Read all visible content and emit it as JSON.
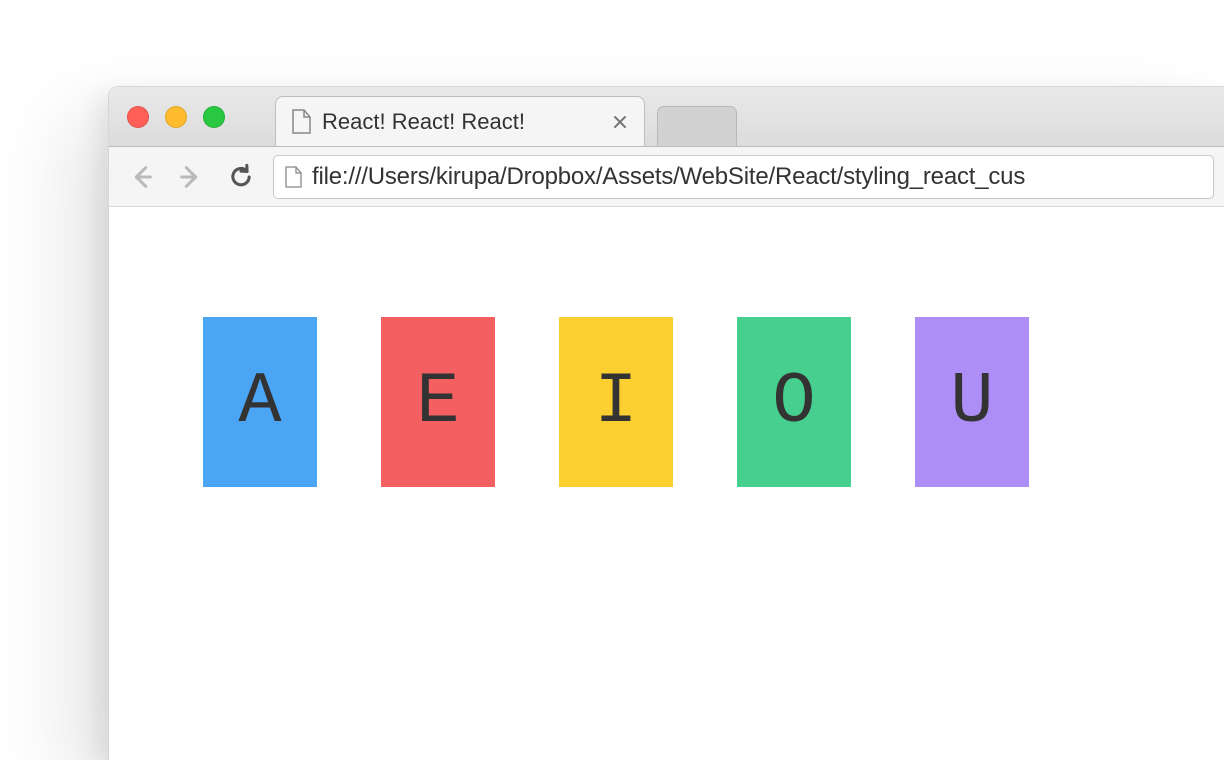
{
  "tab": {
    "title": "React! React! React!"
  },
  "urlbar": {
    "url": "file:///Users/kirupa/Dropbox/Assets/WebSite/React/styling_react_cus"
  },
  "letters": [
    {
      "char": "A",
      "color": "#4aa6f4"
    },
    {
      "char": "E",
      "color": "#f46061"
    },
    {
      "char": "I",
      "color": "#fbcf2f"
    },
    {
      "char": "O",
      "color": "#47cf8f"
    },
    {
      "char": "U",
      "color": "#ad8df6"
    }
  ]
}
